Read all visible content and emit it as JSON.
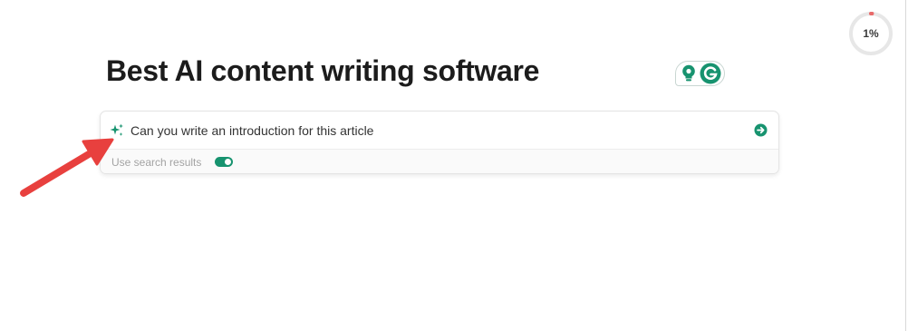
{
  "title": "Best AI content writing software",
  "progress": {
    "label": "1%",
    "value_percent": 1,
    "color": "#e86a6a"
  },
  "prompt": {
    "text": "Can you write an introduction for this article",
    "option_label": "Use search results",
    "option_enabled": true,
    "accent_color": "#17936f"
  },
  "icons": {
    "sparkle": "sparkle-icon",
    "send": "arrow-right-circle-icon",
    "bulb": "lightbulb-icon",
    "grammarly": "grammarly-g-icon",
    "annotation": "red-arrow-annotation"
  }
}
